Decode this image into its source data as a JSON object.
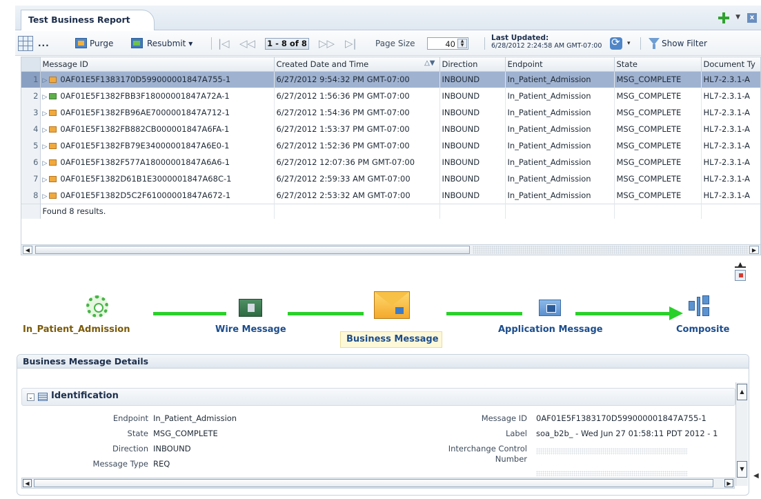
{
  "tab": {
    "title": "Test Business Report",
    "menu_glyph": "▼",
    "close_glyph": "x"
  },
  "toolbar": {
    "more_label": "...",
    "purge_label": "Purge",
    "resubmit_label": "Resubmit ▾",
    "first_glyph": "|◁",
    "prev_glyph": "◁◁",
    "pager_text": "1 - 8 of 8",
    "next_glyph": "▷▷",
    "last_glyph": "▷|",
    "page_size_label": "Page Size",
    "page_size_value": "40",
    "last_updated_label": "Last Updated:",
    "last_updated_value": "6/28/2012 2:24:58 AM GMT-07:00",
    "refresh_menu_glyph": "▾",
    "show_filter_label": "Show Filter"
  },
  "table": {
    "columns": [
      "Message ID",
      "Created Date and Time",
      "Direction",
      "Endpoint",
      "State",
      "Document Ty"
    ],
    "sort_glyph": "△▼",
    "rows": [
      {
        "n": "1",
        "id": "0AF01E5F1383170D599000001847A755-1",
        "created": "6/27/2012 9:54:32 PM GMT-07:00",
        "direction": "INBOUND",
        "endpoint": "In_Patient_Admission",
        "state": "MSG_COMPLETE",
        "doctype": "HL7-2.3.1-A"
      },
      {
        "n": "2",
        "id": "0AF01E5F1382FBB3F18000001847A72A-1",
        "created": "6/27/2012 1:56:36 PM GMT-07:00",
        "direction": "INBOUND",
        "endpoint": "In_Patient_Admission",
        "state": "MSG_COMPLETE",
        "doctype": "HL7-2.3.1-A"
      },
      {
        "n": "3",
        "id": "0AF01E5F1382FB96AE7000001847A712-1",
        "created": "6/27/2012 1:54:36 PM GMT-07:00",
        "direction": "INBOUND",
        "endpoint": "In_Patient_Admission",
        "state": "MSG_COMPLETE",
        "doctype": "HL7-2.3.1-A"
      },
      {
        "n": "4",
        "id": "0AF01E5F1382FB882CB000001847A6FA-1",
        "created": "6/27/2012 1:53:37 PM GMT-07:00",
        "direction": "INBOUND",
        "endpoint": "In_Patient_Admission",
        "state": "MSG_COMPLETE",
        "doctype": "HL7-2.3.1-A"
      },
      {
        "n": "5",
        "id": "0AF01E5F1382FB79E34000001847A6E0-1",
        "created": "6/27/2012 1:52:36 PM GMT-07:00",
        "direction": "INBOUND",
        "endpoint": "In_Patient_Admission",
        "state": "MSG_COMPLETE",
        "doctype": "HL7-2.3.1-A"
      },
      {
        "n": "6",
        "id": "0AF01E5F1382F577A18000001847A6A6-1",
        "created": "6/27/2012 12:07:36 PM GMT-07:00",
        "direction": "INBOUND",
        "endpoint": "In_Patient_Admission",
        "state": "MSG_COMPLETE",
        "doctype": "HL7-2.3.1-A"
      },
      {
        "n": "7",
        "id": "0AF01E5F1382D61B1E3000001847A68C-1",
        "created": "6/27/2012 2:59:33 AM GMT-07:00",
        "direction": "INBOUND",
        "endpoint": "In_Patient_Admission",
        "state": "MSG_COMPLETE",
        "doctype": "HL7-2.3.1-A"
      },
      {
        "n": "8",
        "id": "0AF01E5F1382D5C2F61000001847A672-1",
        "created": "6/27/2012 2:53:32 AM GMT-07:00",
        "direction": "INBOUND",
        "endpoint": "In_Patient_Admission",
        "state": "MSG_COMPLETE",
        "doctype": "HL7-2.3.1-A"
      }
    ],
    "footer": "Found 8 results.",
    "scroll_left_glyph": "◀",
    "scroll_right_glyph": "▶"
  },
  "flow": {
    "node1": "In_Patient_Admission",
    "node2": "Wire Message",
    "node3": "Business Message",
    "node4": "Application Message",
    "node5": "Composite",
    "collapse_glyph": "▲"
  },
  "details": {
    "header": "Business Message Details",
    "section_toggle": "⌄",
    "section_title": "Identification",
    "left": [
      {
        "label": "Endpoint",
        "value": "In_Patient_Admission"
      },
      {
        "label": "State",
        "value": "MSG_COMPLETE"
      },
      {
        "label": "Direction",
        "value": "INBOUND"
      },
      {
        "label": "Message Type",
        "value": "REQ"
      }
    ],
    "right": {
      "message_id_label": "Message ID",
      "message_id_value": "0AF01E5F1383170D599000001847A755-1",
      "label_label": "Label",
      "label_value": "soa_b2b_ - Wed Jun 27 01:58:11 PDT 2012 - 1",
      "icn_label_1": "Interchange Control",
      "icn_label_2": "Number"
    },
    "scroll_up_glyph": "▲",
    "scroll_down_glyph": "▼",
    "scroll_left_glyph": "◀",
    "scroll_right_glyph": "▶",
    "side_glyph": "◀"
  },
  "colors": {
    "flow_line": "#2ad02a",
    "selected_row": "#9fb2d0",
    "title_text": "#1d2f4c"
  }
}
